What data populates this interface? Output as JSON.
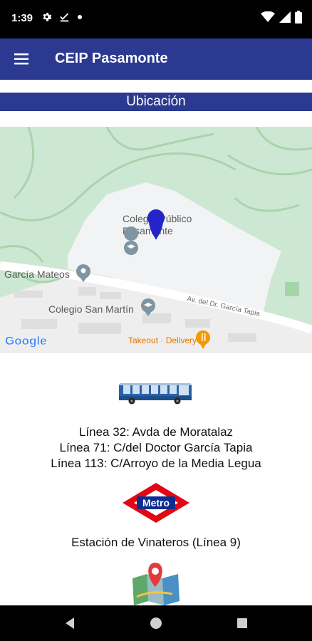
{
  "status_bar": {
    "time": "1:39",
    "left_icons": [
      "gear-icon",
      "download-done-icon",
      "dot-icon"
    ],
    "right_icons": [
      "wifi-icon",
      "signal-icon",
      "battery-icon"
    ]
  },
  "app_bar": {
    "title": "CEIP Pasamonte",
    "menu_icon": "hamburger-menu-icon",
    "color": "#2b3990"
  },
  "section": {
    "title": "Ubicación"
  },
  "map": {
    "labels": {
      "school": "Colegio Público\nPasamonte",
      "school_line1": "Colegio Público",
      "school_line2": "Pasamonte",
      "garcia_mateos": "García Mateos",
      "colegio_san_martin": "Colegio San Martín",
      "street": "Av. del Dr. García Tapia",
      "takeout": "Takeout · Delivery",
      "brand": "Google"
    },
    "marker_color": "#1a1adf"
  },
  "transport": {
    "bus_lines": [
      "Línea 32: Avda de Moratalaz",
      "Línea 71: C/del Doctor García Tapia",
      "Línea 113: C/Arroyo de la Media Legua"
    ],
    "metro_logo_text": "Metro",
    "station": "Estación de Vinateros (Línea 9)"
  },
  "nav_bar": {
    "buttons": [
      "back-icon",
      "home-icon",
      "recents-icon"
    ]
  }
}
